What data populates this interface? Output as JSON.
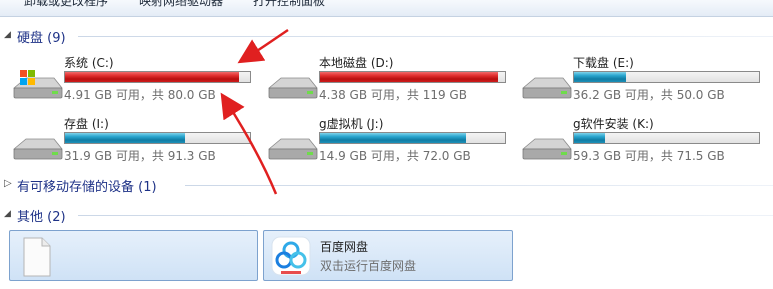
{
  "toolbar": {
    "items": [
      "卸载或更改程序",
      "映射网络驱动器",
      "打开控制面板"
    ]
  },
  "groups": {
    "hdd": {
      "title": "硬盘 (9)",
      "expanded": true
    },
    "removable": {
      "title": "有可移动存储的设备 (1)",
      "expanded": false
    },
    "other": {
      "title": "其他 (2)",
      "expanded": true
    }
  },
  "drives": [
    {
      "name": "系统 (C:)",
      "free": "4.91 GB 可用，共 80.0 GB",
      "used_fraction": 0.94,
      "bar_color": "red",
      "icon": "windows-drive-icon"
    },
    {
      "name": "本地磁盘 (D:)",
      "free": "4.38 GB 可用，共 119 GB",
      "used_fraction": 0.96,
      "bar_color": "red",
      "icon": "hard-drive-icon"
    },
    {
      "name": "下载盘 (E:)",
      "free": "36.2 GB 可用，共 50.0 GB",
      "used_fraction": 0.28,
      "bar_color": "blue",
      "icon": "hard-drive-icon"
    },
    {
      "name": "存盘 (I:)",
      "free": "31.9 GB 可用，共 91.3 GB",
      "used_fraction": 0.65,
      "bar_color": "blue",
      "icon": "hard-drive-icon"
    },
    {
      "name": "g虚拟机 (J:)",
      "free": "14.9 GB 可用，共 72.0 GB",
      "used_fraction": 0.79,
      "bar_color": "blue",
      "icon": "hard-drive-icon"
    },
    {
      "name": "g软件安装 (K:)",
      "free": "59.3 GB 可用，共 71.5 GB",
      "used_fraction": 0.17,
      "bar_color": "blue",
      "icon": "hard-drive-icon"
    }
  ],
  "other_items": [
    {
      "title": "",
      "subtitle": "",
      "icon": "blank-file-icon"
    },
    {
      "title": "百度网盘",
      "subtitle": "双击运行百度网盘",
      "icon": "baidu-netdisk-icon"
    }
  ],
  "colors": {
    "bar_red": "#d01c1c",
    "bar_blue": "#1d91b9",
    "annotation_red": "#e02020",
    "group_title": "#1e3287"
  }
}
